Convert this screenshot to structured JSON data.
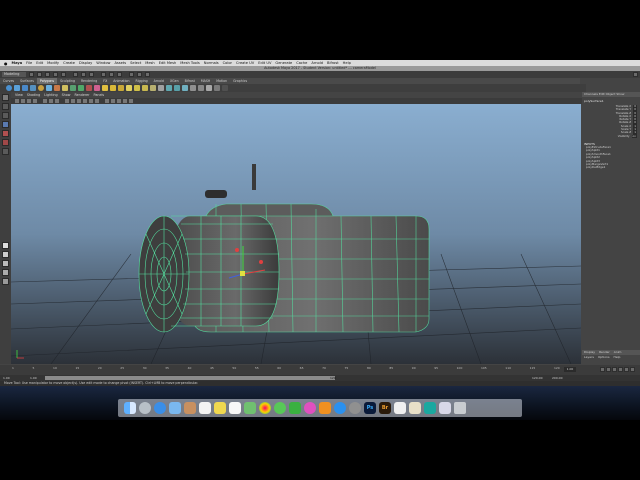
{
  "menu_bar": {
    "items": [
      "Maya",
      "File",
      "Edit",
      "Modify",
      "Create",
      "Display",
      "Window",
      "Assets",
      "Select",
      "Mesh",
      "Edit Mesh",
      "Mesh Tools",
      "Normals",
      "Color",
      "Create UV",
      "Edit UV",
      "Generate",
      "Cache",
      "Arnold",
      "Bifrost",
      "Help"
    ]
  },
  "window_title": "Autodesk Maya 2017 - Student Version: untitled* --- cameraModel",
  "mode_selector": {
    "value": "Modeling"
  },
  "shelf_tabs": [
    "Curves",
    "Surfaces",
    "Polygons",
    "Sculpting",
    "Rendering",
    "FX",
    "Animation",
    "Rigging",
    "Arnold",
    "XGen",
    "Bifrost",
    "MASH",
    "Motion",
    "Graphics"
  ],
  "shelf_active_tab": "Polygons",
  "panel_menu": [
    "View",
    "Shading",
    "Lighting",
    "Show",
    "Renderer",
    "Panels"
  ],
  "channel_box": {
    "header": "Channels  Edit  Object  Show",
    "object_name": "polySurface1",
    "attributes": [
      {
        "name": "Translate X",
        "value": "0"
      },
      {
        "name": "Translate Y",
        "value": "0"
      },
      {
        "name": "Translate Z",
        "value": "0"
      },
      {
        "name": "Rotate X",
        "value": "0"
      },
      {
        "name": "Rotate Y",
        "value": "0"
      },
      {
        "name": "Rotate Z",
        "value": "0"
      },
      {
        "name": "Scale X",
        "value": "1"
      },
      {
        "name": "Scale Y",
        "value": "1"
      },
      {
        "name": "Scale Z",
        "value": "1"
      },
      {
        "name": "Visibility",
        "value": "on"
      }
    ],
    "inputs_title": "INPUTS",
    "inputs": [
      "polyExtrudeFace1",
      "polySplit1",
      "polySmoothFace1",
      "polySplit2",
      "polySplit3",
      "polyMergeVert1",
      "polyDelEdge1"
    ],
    "layer_tabs": [
      "Display",
      "Render",
      "Anim"
    ],
    "layer_menu": [
      "Layers",
      "Options",
      "Help"
    ]
  },
  "timeline": {
    "ticks": [
      "1",
      "5",
      "10",
      "15",
      "20",
      "25",
      "30",
      "35",
      "40",
      "45",
      "50",
      "55",
      "60",
      "65",
      "70",
      "75",
      "80",
      "85",
      "90",
      "95",
      "100",
      "105",
      "110",
      "115",
      "120"
    ],
    "current_frame": "1.00"
  },
  "range_bar": {
    "start": "1.00",
    "range_start": "1.00",
    "range_end": "120",
    "end": "120.00",
    "end2": "200.00"
  },
  "help_line": "Move Tool: Use manipulator to move object(s). Use edit mode to change pivot (INSERT). Ctrl+LMB to move perpendicular.",
  "dock": {
    "icons": [
      "finder-icon",
      "launchpad-icon",
      "safari-icon",
      "mail-icon",
      "contacts-icon",
      "calendar-icon",
      "notes-icon",
      "reminders-icon",
      "maps-icon",
      "photos-icon",
      "messages-icon",
      "facetime-icon",
      "itunes-icon",
      "ibooks-icon",
      "appstore-icon",
      "preferences-icon",
      "photoshop-icon",
      "bridge-icon",
      "illustrator-icon",
      "folder-icon",
      "maya-icon",
      "preview-icon",
      "trash-icon"
    ],
    "labels": {
      "ps": "Ps",
      "br": "Br"
    }
  },
  "colors": {
    "viewport_top": "#88a8c8",
    "viewport_bottom": "#2a2f36",
    "wireframe": "#55e0a0",
    "shelf_active": "#6c6c6c"
  }
}
